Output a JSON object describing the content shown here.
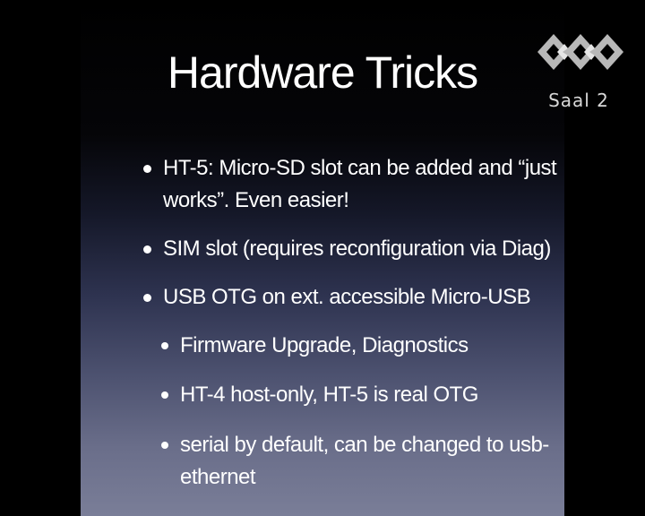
{
  "slide": {
    "title": "Hardware Tricks",
    "logo_icon": "ccc-cube-logo",
    "logo_label": "Saal 2",
    "bullets": [
      {
        "level": 1,
        "text_line1": "HT-5: Micro-SD slot can be added and “just",
        "text_line2": "works”. Even easier!"
      },
      {
        "level": 1,
        "text_line1": "SIM slot (requires reconfiguration via Diag)"
      },
      {
        "level": 1,
        "text_line1": "USB OTG on ext. accessible Micro-USB"
      },
      {
        "level": 2,
        "text_line1": "Firmware Upgrade, Diagnostics"
      },
      {
        "level": 2,
        "text_line1": "HT-4 host-only, HT-5 is real OTG"
      },
      {
        "level": 2,
        "text_line1": "serial by default, can be changed to usb-",
        "text_line2": "ethernet"
      }
    ]
  },
  "colors": {
    "background": "#000000",
    "text": "#ffffff",
    "logo_fill": "#b8b8b8"
  }
}
